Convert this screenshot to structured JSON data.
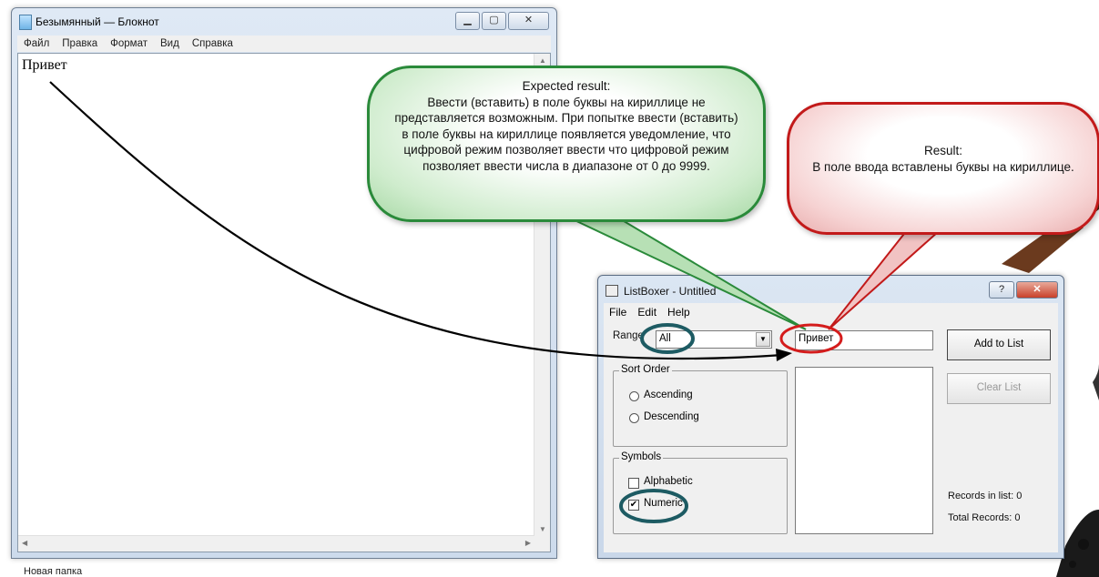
{
  "colors": {
    "green_callout_border": "#2a8a3a",
    "red_callout_border": "#c21a1a",
    "highlight_teal": "#1d5b63",
    "highlight_red": "#d41c1c"
  },
  "desktop": {
    "bottom_label": "Новая папка"
  },
  "notepad": {
    "title": "Безымянный — Блокнот",
    "menu": [
      "Файл",
      "Правка",
      "Формат",
      "Вид",
      "Справка"
    ],
    "content": "Привет"
  },
  "callouts": {
    "expected": {
      "heading": "Expected result:",
      "body": "Ввести (вставить) в поле буквы на кириллице не представляется возможным. При попытке ввести (вставить) в поле буквы на кириллице появляется уведомление, что цифровой режим позволяет ввести  что цифровой режим позволяет ввести числа в диапазоне от 0 до 9999."
    },
    "result": {
      "heading": "Result:",
      "body": "В поле ввода вставлены буквы на кириллице."
    }
  },
  "listboxer": {
    "title": "ListBoxer - Untitled",
    "title_buttons": {
      "help": "?",
      "close": "✕"
    },
    "menu": [
      "File",
      "Edit",
      "Help"
    ],
    "range_label": "Range",
    "range_value": "All",
    "input_value": "Привет",
    "sort_order": {
      "title": "Sort Order",
      "options": [
        "Ascending",
        "Descending"
      ]
    },
    "symbols": {
      "title": "Symbols",
      "alphabetic": {
        "label": "Alphabetic",
        "checked": false
      },
      "numeric": {
        "label": "Numeric",
        "checked": true
      }
    },
    "add_button": "Add to List",
    "clear_button": "Clear List",
    "records_in_list": "Records in list: 0",
    "total_records": "Total Records: 0"
  }
}
